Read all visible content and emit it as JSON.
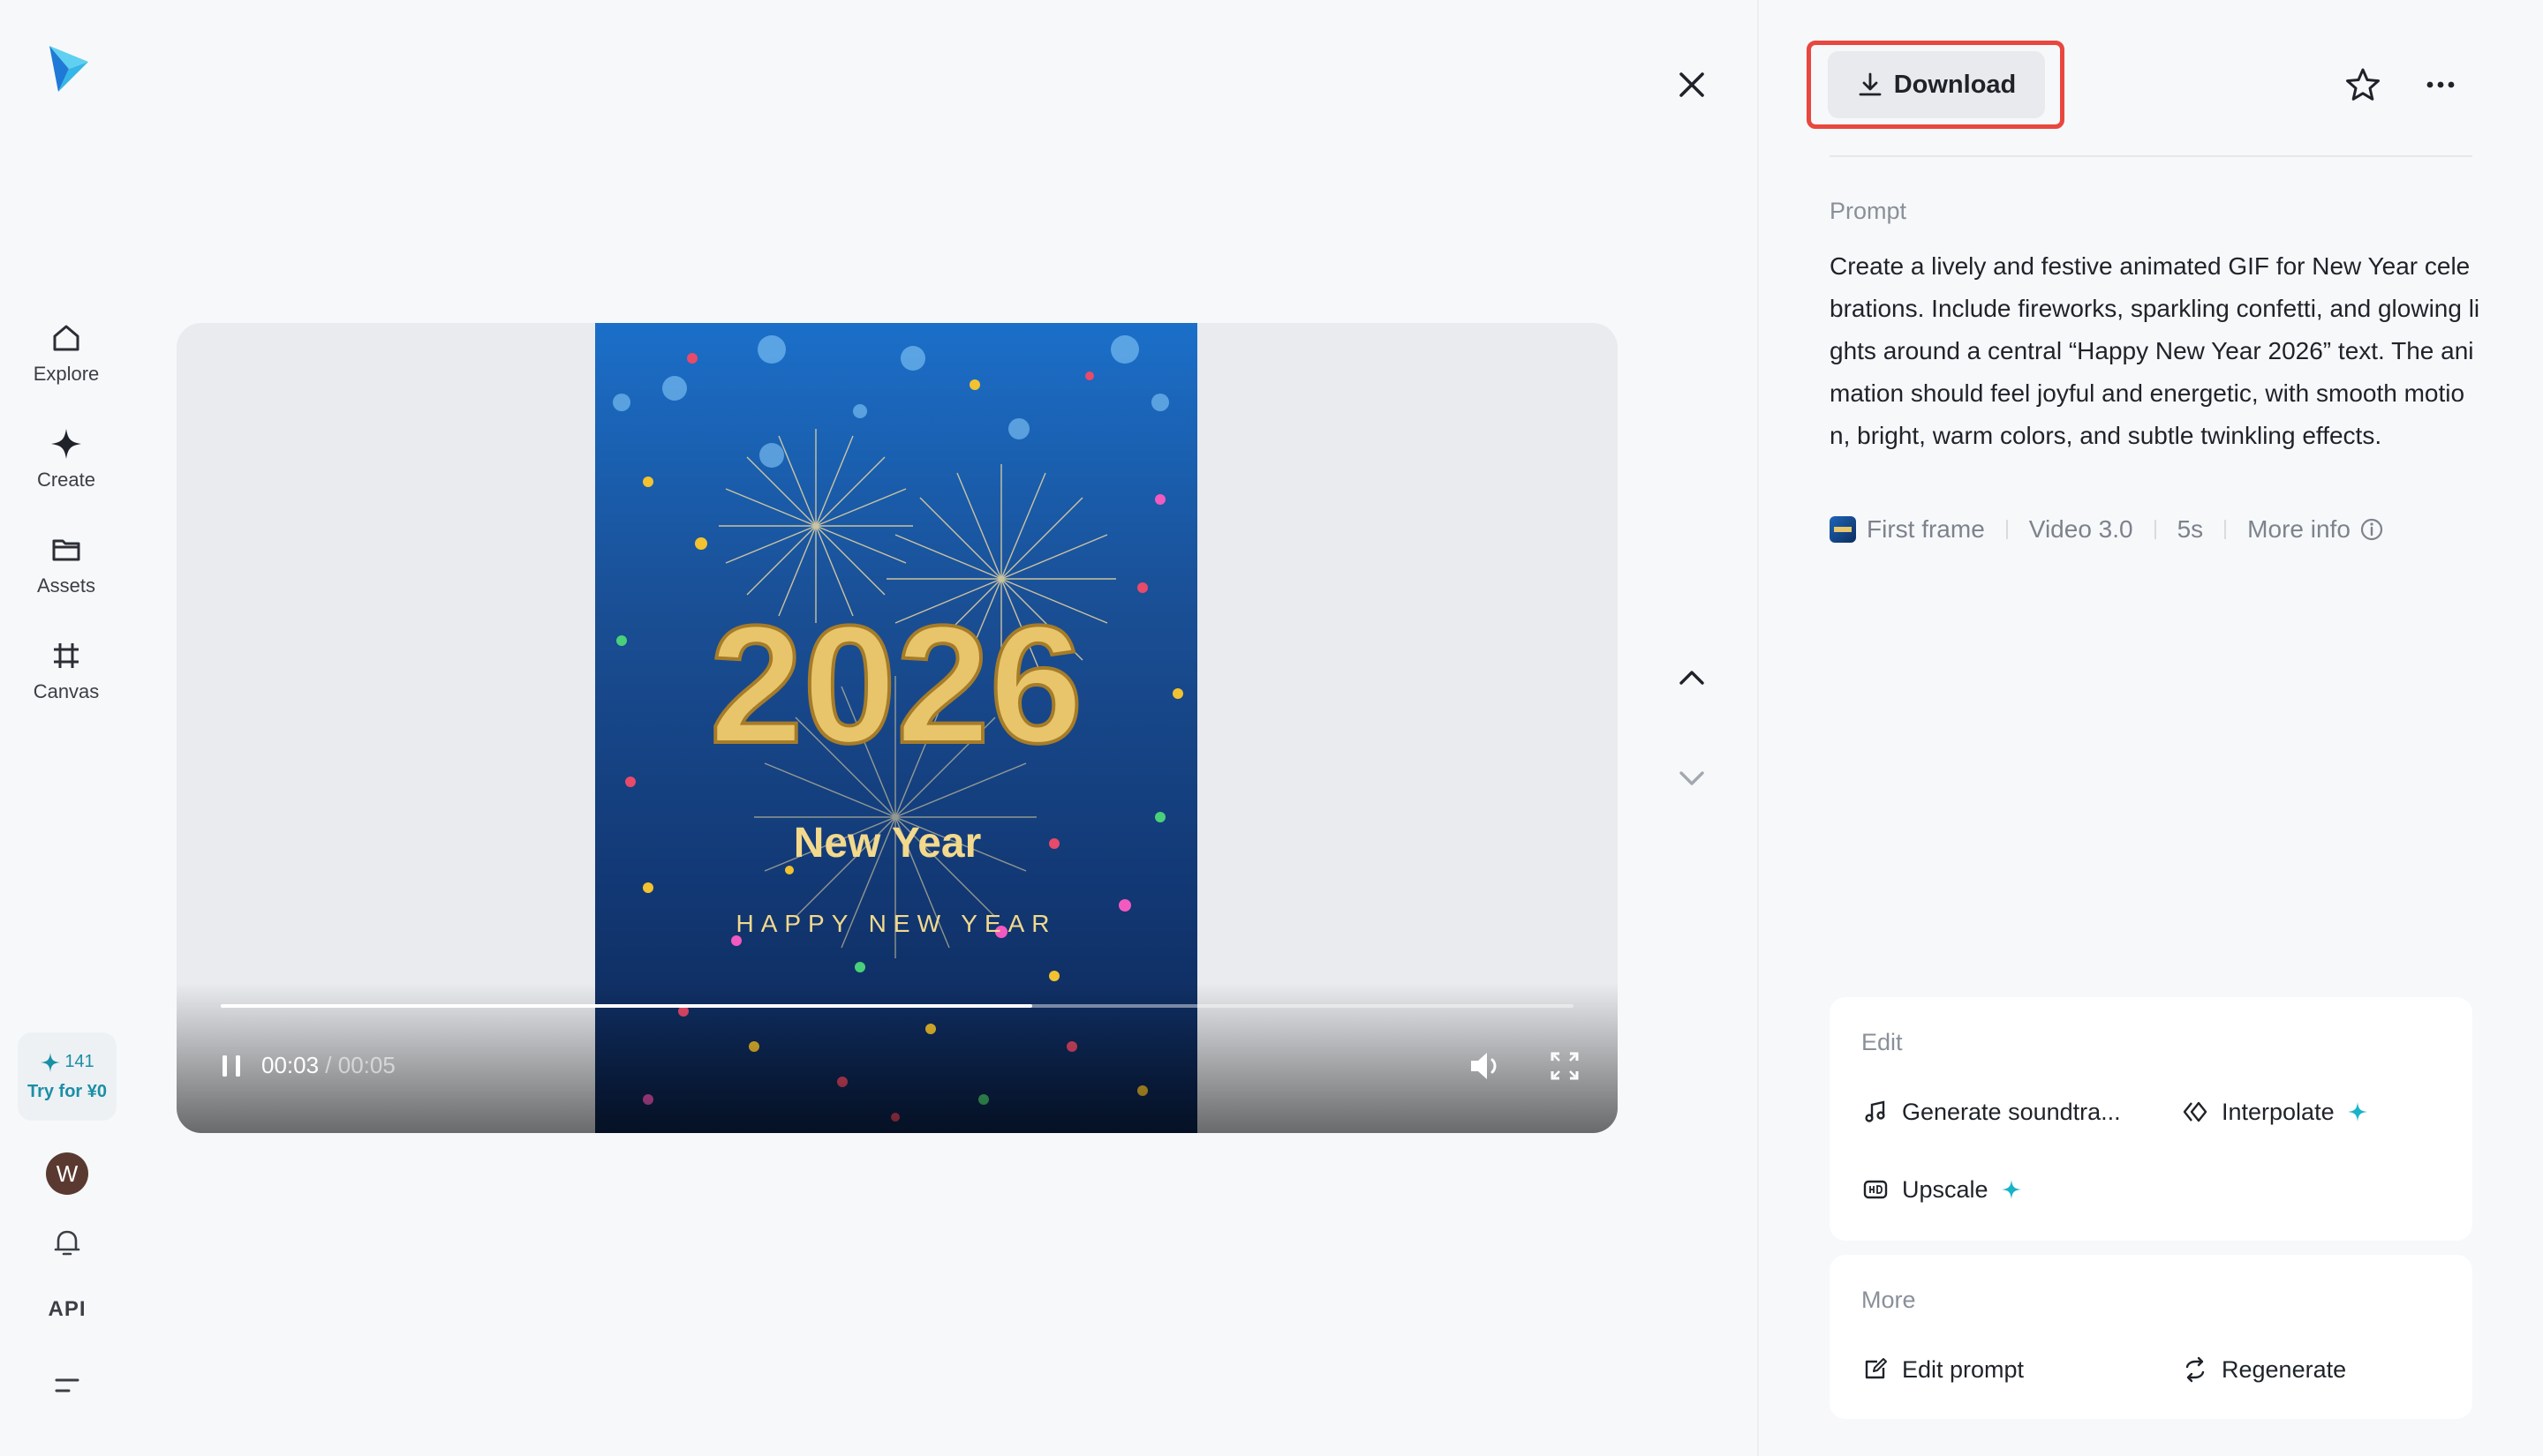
{
  "sidebar": {
    "items": [
      {
        "label": "Explore",
        "icon": "home-icon"
      },
      {
        "label": "Create",
        "icon": "sparkle-icon"
      },
      {
        "label": "Assets",
        "icon": "folder-icon"
      },
      {
        "label": "Canvas",
        "icon": "crop-icon"
      }
    ],
    "promo": {
      "credits": "141",
      "try_label": "Try for ¥0"
    },
    "avatar_initial": "W",
    "api_label": "API"
  },
  "player": {
    "current_time": "00:03",
    "duration": " / 00:05",
    "progress": 0.6,
    "video_text": {
      "year": "2026",
      "title": "New Year",
      "tagline": "HAPPY NEW YEAR"
    }
  },
  "panel": {
    "download_label": "Download",
    "prompt_label": "Prompt",
    "prompt_text": "Create a lively and festive animated GIF for New Year celebrations. Include fireworks, sparkling confetti, and glowing lights around a central “Happy New Year 2026” text. The animation should feel joyful and energetic, with smooth motion, bright, warm colors, and subtle twinkling effects.",
    "meta": {
      "first_frame": "First frame",
      "model": "Video 3.0",
      "length": "5s",
      "more_info": "More info"
    },
    "edit": {
      "title": "Edit",
      "generate_soundtrack": "Generate soundtra...",
      "interpolate": "Interpolate",
      "upscale": "Upscale"
    },
    "more": {
      "title": "More",
      "edit_prompt": "Edit prompt",
      "regenerate": "Regenerate"
    }
  },
  "colors": {
    "accent": "#1a8fa6",
    "highlight_border": "#e8473f",
    "spark": "#19b3c9"
  }
}
